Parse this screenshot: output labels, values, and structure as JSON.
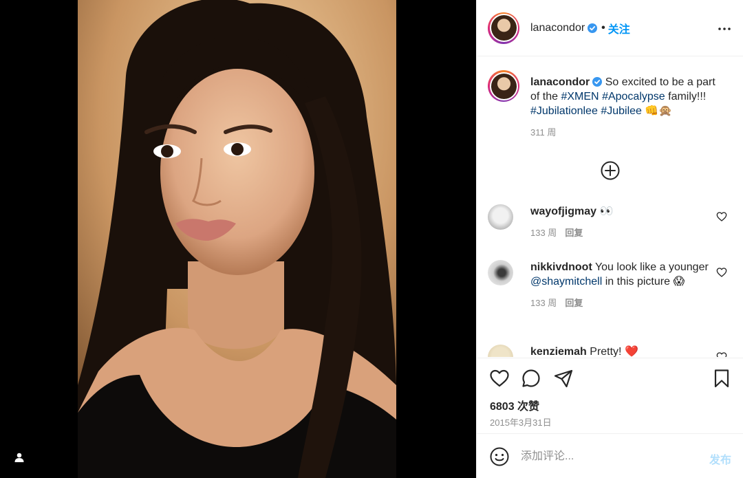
{
  "post": {
    "username": "lanacondor",
    "follow_label": "关注",
    "separator": "•",
    "more_icon": "more-horizontal-icon"
  },
  "caption": {
    "username": "lanacondor",
    "text_1": "So excited to be a part of the ",
    "tag_1": "#XMEN",
    "tag_2": "#Apocalypse",
    "text_2": " family!!! ",
    "tag_3": "#Jubilationlee",
    "tag_4": "#Jubilee",
    "emoji": "👊🙊",
    "time": "311 周"
  },
  "comments": [
    {
      "username": "wayofjigmay",
      "text": "👀",
      "time": "133 周",
      "reply_label": "回复"
    },
    {
      "username": "nikkivdnoot",
      "text_1": "You look like a younger ",
      "mention": "@shaymitchell",
      "text_2": " in this picture 😱",
      "time": "133 周",
      "reply_label": "回复"
    },
    {
      "username": "kenziemah",
      "text": "Pretty! ❤️"
    }
  ],
  "stats": {
    "likes": "6803 次赞",
    "date": "2015年3月31日"
  },
  "composer": {
    "placeholder": "添加评论...",
    "post_label": "发布"
  },
  "colors": {
    "accent": "#0095f6",
    "link": "#00376b",
    "muted": "#8e8e8e",
    "post_disabled": "#b2dffc"
  }
}
